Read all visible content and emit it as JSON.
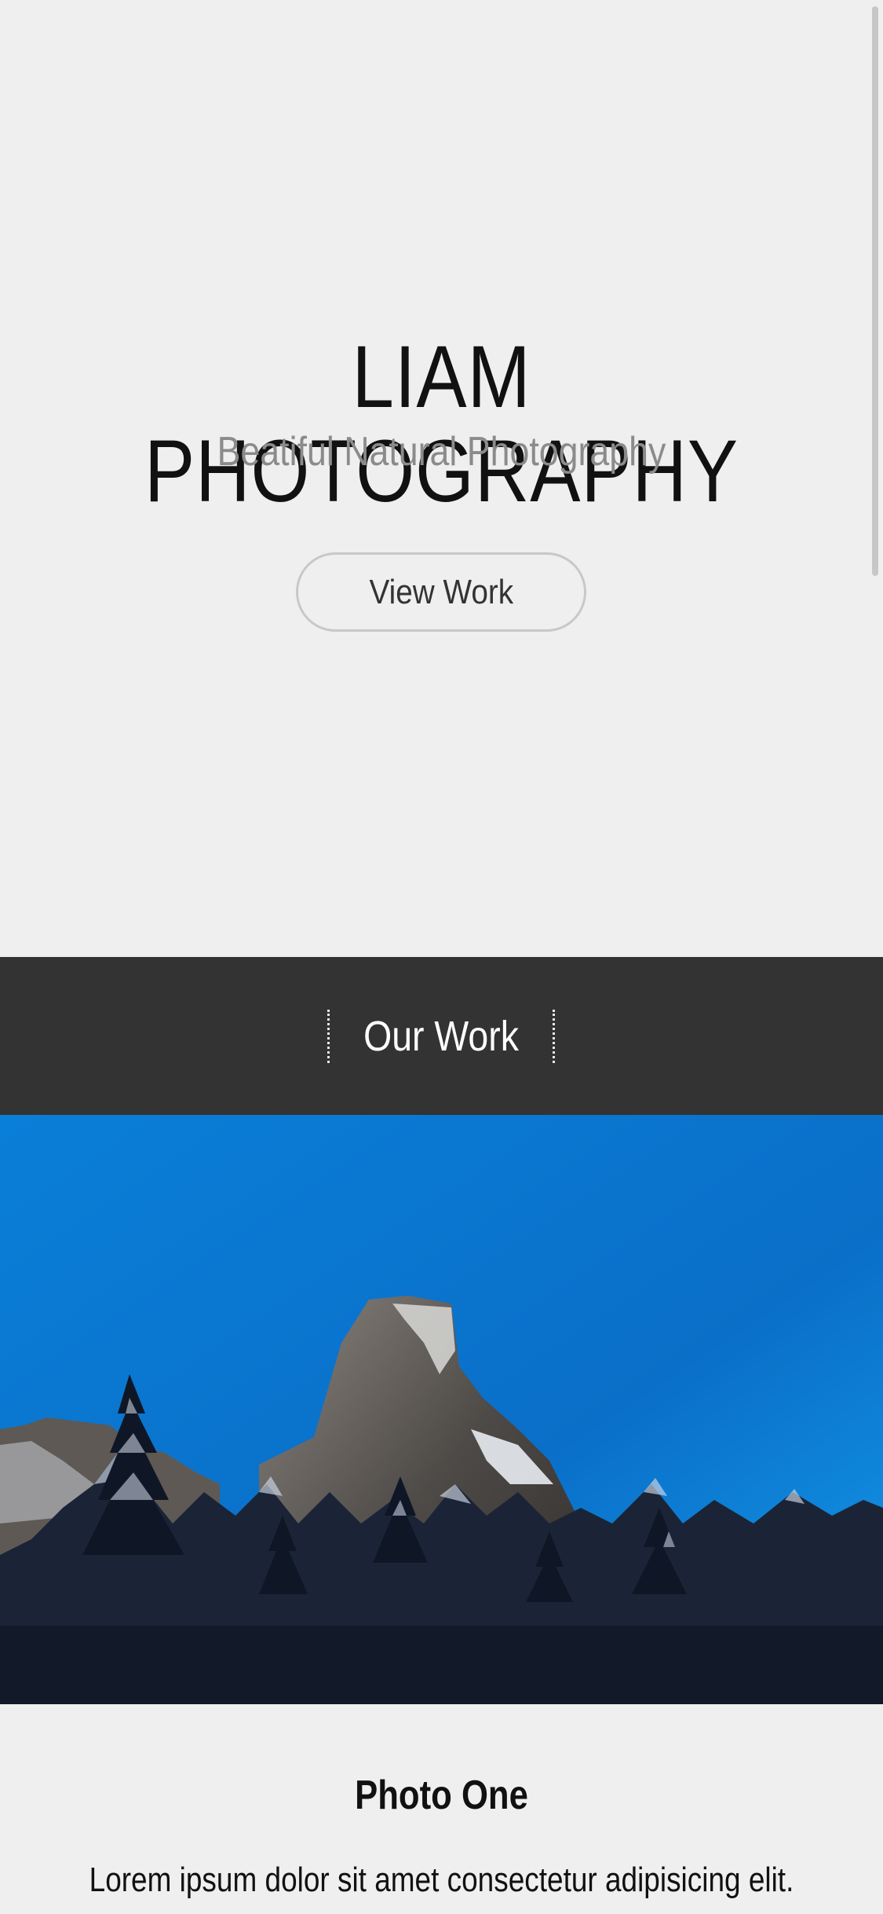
{
  "hero": {
    "title": "LIAM PHOTOGRAPHY",
    "subtitle": "Beatiful Natural Photography",
    "button_label": "View Work"
  },
  "section": {
    "title": "Our Work"
  },
  "photo": {
    "title": "Photo One",
    "text": "Lorem ipsum dolor sit amet consectetur adipisicing elit."
  },
  "colors": {
    "background": "#efefef",
    "band": "#333333",
    "sky_top": "#0a70c8",
    "sky_bottom": "#108fe0"
  }
}
